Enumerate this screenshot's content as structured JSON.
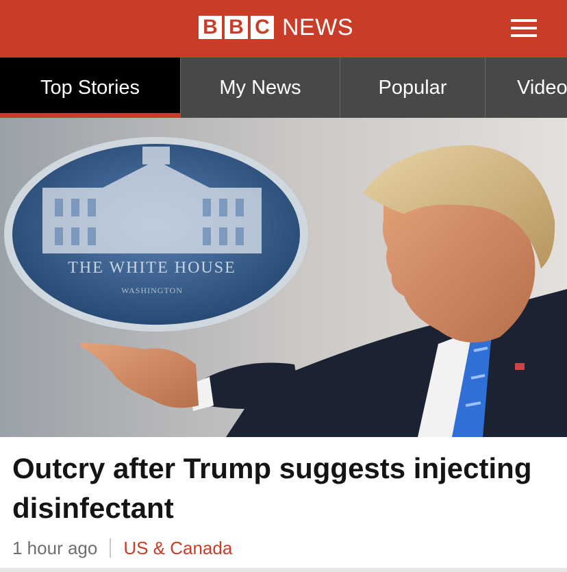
{
  "header": {
    "logo_letters": [
      "B",
      "B",
      "C"
    ],
    "logo_word": "NEWS",
    "brand_color": "#c83c28",
    "menu_icon": "hamburger-menu-icon"
  },
  "tabs": [
    {
      "label": "Top Stories",
      "active": true
    },
    {
      "label": "My News",
      "active": false
    },
    {
      "label": "Popular",
      "active": false
    },
    {
      "label": "Video",
      "active": false
    }
  ],
  "article": {
    "headline": "Outcry after Trump suggests injecting disinfectant",
    "time": "1 hour ago",
    "section": "US & Canada",
    "hero_seal_text": "THE WHITE HOUSE",
    "hero_seal_subtext": "WASHINGTON"
  },
  "colors": {
    "tab_bar": "#484848",
    "active_tab": "#000000",
    "section_link": "#c83c28"
  }
}
